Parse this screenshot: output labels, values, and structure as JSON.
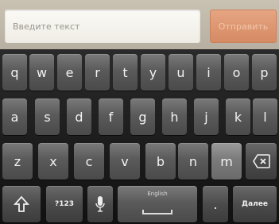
{
  "input": {
    "placeholder": "Введите текст"
  },
  "send": {
    "label": "Отправить"
  },
  "keyboard": {
    "row1": [
      "q",
      "w",
      "e",
      "r",
      "t",
      "y",
      "u",
      "i",
      "o",
      "p"
    ],
    "row2": [
      "a",
      "s",
      "d",
      "f",
      "g",
      "h",
      "j",
      "k",
      "l"
    ],
    "row3": [
      "z",
      "x",
      "c",
      "v",
      "b",
      "n",
      "m"
    ],
    "symbols_label": "?123",
    "space_label": "English",
    "period_label": ".",
    "enter_label": "Далее",
    "icons": {
      "shift": "shift-icon",
      "mic": "microphone-icon",
      "delete": "delete-icon",
      "space": "space-bar-icon"
    }
  },
  "colors": {
    "send_button": "#d58a63",
    "keyboard_bg": "#111111",
    "key": "#5a5a5a"
  }
}
